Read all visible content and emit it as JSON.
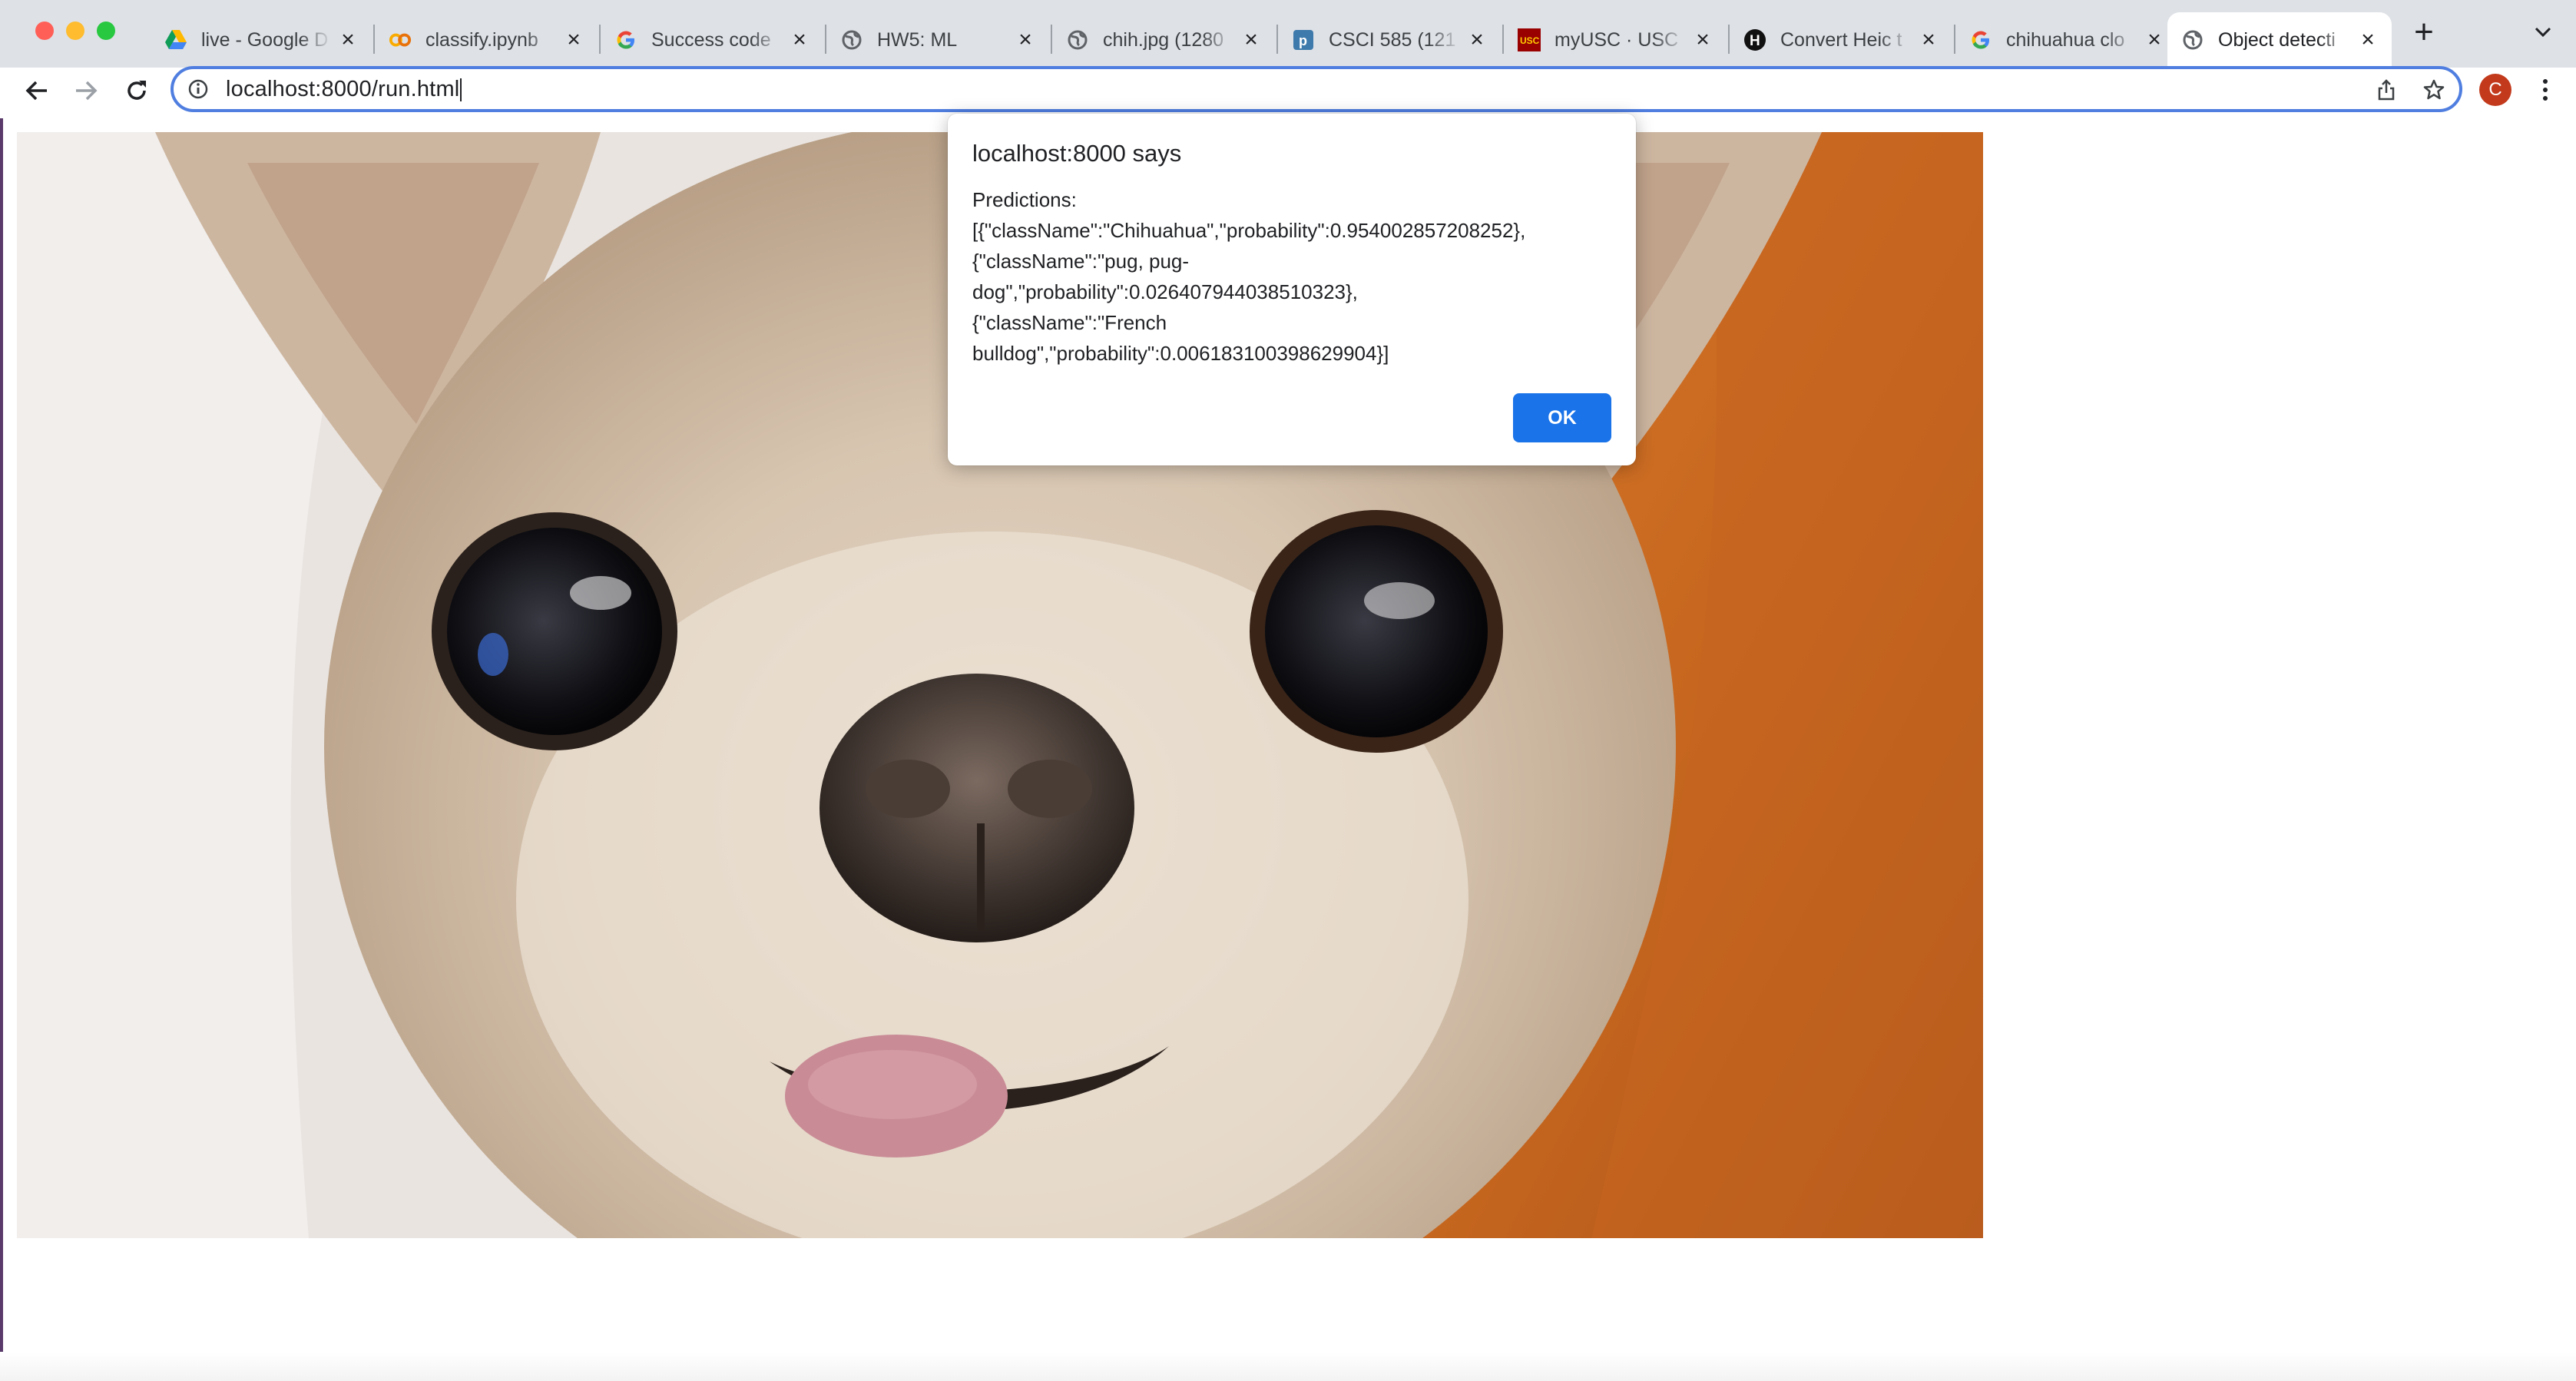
{
  "browser": {
    "tabs": [
      {
        "title": "live - Google D",
        "icon": "google-drive-icon"
      },
      {
        "title": "classify.ipynb",
        "icon": "colab-icon"
      },
      {
        "title": "Success code",
        "icon": "google-icon"
      },
      {
        "title": "HW5: ML",
        "icon": "globe-icon"
      },
      {
        "title": "chih.jpg (1280",
        "icon": "globe-icon"
      },
      {
        "title": "CSCI 585 (121",
        "icon": "piazza-icon"
      },
      {
        "title": "myUSC · USC",
        "icon": "usc-icon"
      },
      {
        "title": "Convert Heic t",
        "icon": "h-icon"
      },
      {
        "title": "chihuahua clo",
        "icon": "google-icon"
      },
      {
        "title": "Object detecti",
        "icon": "globe-icon",
        "active": true
      }
    ],
    "url": "localhost:8000/run.html",
    "profile_initial": "C"
  },
  "dialog": {
    "title": "localhost:8000 says",
    "message": "Predictions:\n[{\"className\":\"Chihuahua\",\"probability\":0.954002857208252},\n{\"className\":\"pug, pug-\ndog\",\"probability\":0.026407944038510323},\n{\"className\":\"French\nbulldog\",\"probability\":0.006183100398629904}]",
    "ok_label": "OK"
  },
  "colors": {
    "accent": "#1a73e8",
    "tabstrip": "#dee1e6",
    "avatar": "#c2391b"
  }
}
